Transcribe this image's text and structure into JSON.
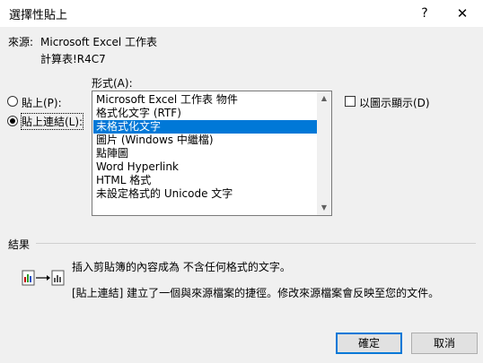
{
  "dialog": {
    "title": "選擇性貼上",
    "help": "?",
    "close": "✕"
  },
  "source": {
    "label": "來源:",
    "app": "Microsoft Excel 工作表",
    "range": "計算表!R4C7"
  },
  "format_label": "形式(A):",
  "options": {
    "paste_label": "貼上(P):",
    "paste_link_label": "貼上連結(L):",
    "selected": "paste_link"
  },
  "formats": {
    "items": [
      "Microsoft Excel 工作表 物件",
      "格式化文字 (RTF)",
      "未格式化文字",
      "圖片 (Windows 中繼檔)",
      "點陣圖",
      "Word Hyperlink",
      "HTML 格式",
      "未設定格式的 Unicode 文字"
    ],
    "selected_index": 2
  },
  "display_as_icon": {
    "label": "以圖示顯示(D)",
    "checked": false
  },
  "result": {
    "heading": "結果",
    "line1": "插入剪貼簿的內容成為 不含任何格式的文字。",
    "line2": "[貼上連結] 建立了一個與來源檔案的捷徑。修改來源檔案會反映至您的文件。"
  },
  "buttons": {
    "ok": "確定",
    "cancel": "取消"
  },
  "colors": {
    "accent": "#0078d7",
    "dialog_bg": "#f0f0f0"
  }
}
